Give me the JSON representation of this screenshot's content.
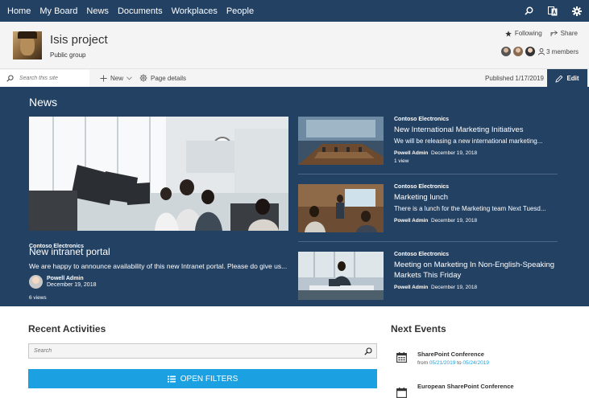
{
  "nav": {
    "items": [
      "Home",
      "My Board",
      "News",
      "Documents",
      "Workplaces",
      "People"
    ],
    "icons": [
      "search-icon",
      "translate-icon",
      "gear-icon"
    ]
  },
  "site": {
    "title": "Isis project",
    "subtitle": "Public group",
    "following_label": "Following",
    "share_label": "Share",
    "members_label": "3 members"
  },
  "cmdbar": {
    "search_placeholder": "Search this site",
    "new_label": "New",
    "page_details_label": "Page details",
    "published_label": "Published 1/17/2019",
    "edit_label": "Edit"
  },
  "news": {
    "title": "News",
    "hero": {
      "tag": "Contoso Electronics",
      "headline": "New intranet portal",
      "description": "We are happy to announce availability of this new Intranet portal. Please do give us...",
      "author": "Powell Admin",
      "date": "December 19, 2018",
      "views": "6 views"
    },
    "cards": [
      {
        "tag": "Contoso Electronics",
        "headline": "New International Marketing Initiatives",
        "description": "We will be releasing a new international marketing...",
        "author": "Powell Admin",
        "date": "December 19, 2018",
        "views": "1 view"
      },
      {
        "tag": "Contoso Electronics",
        "headline": "Marketing lunch",
        "description": "There is a lunch for the Marketing team Next Tuesd...",
        "author": "Powell Admin",
        "date": "December 19, 2018",
        "views": ""
      },
      {
        "tag": "Contoso Electronics",
        "headline": "Meeting on Marketing In Non-English-Speaking Markets This Friday",
        "description": "",
        "author": "Powell Admin",
        "date": "December 19, 2018",
        "views": ""
      }
    ]
  },
  "recent": {
    "title": "Recent Activities",
    "search_placeholder": "Search",
    "filters_label": "OPEN FILTERS"
  },
  "events": {
    "title": "Next Events",
    "items": [
      {
        "name": "SharePoint Conference",
        "from_label": "from",
        "start": "05/21/2019",
        "to_label": "to",
        "end": "05/24/2019"
      },
      {
        "name": "European SharePoint Conference",
        "from_label": "",
        "start": "",
        "to_label": "",
        "end": ""
      }
    ]
  },
  "colors": {
    "primary": "#234163",
    "accent": "#1ba1e2",
    "header_bg": "#f4f4f4"
  }
}
